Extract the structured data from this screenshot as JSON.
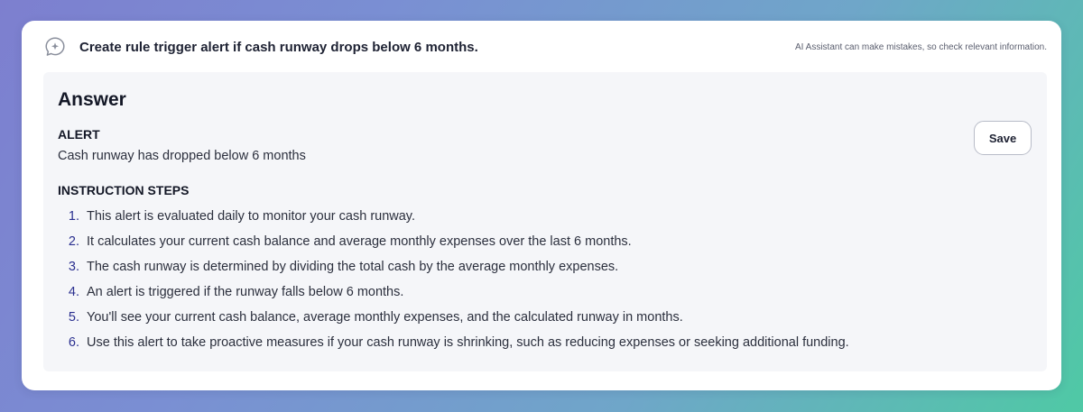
{
  "prompt": {
    "icon": "chat-sparkle-icon",
    "text": "Create rule trigger alert if cash runway drops below 6 months."
  },
  "disclaimer": "AI Assistant can make mistakes, so check relevant information.",
  "answer": {
    "title": "Answer",
    "save_label": "Save",
    "alert_label": "ALERT",
    "alert_text": "Cash runway has dropped below 6 months",
    "steps_heading": "INSTRUCTION STEPS",
    "steps": [
      {
        "num": "1.",
        "text": "This alert is evaluated daily to monitor your cash runway."
      },
      {
        "num": "2.",
        "text": "It calculates your current cash balance and average monthly expenses over the last 6 months."
      },
      {
        "num": "3.",
        "text": "The cash runway is determined by dividing the total cash by the average monthly expenses."
      },
      {
        "num": "4.",
        "text": "An alert is triggered if the runway falls below 6 months."
      },
      {
        "num": "5.",
        "text": "You'll see your current cash balance, average monthly expenses, and the calculated runway in months."
      },
      {
        "num": "6.",
        "text": "Use this alert to take proactive measures if your cash runway is shrinking, such as reducing expenses or seeking additional funding."
      }
    ]
  },
  "colors": {
    "accent_number": "#2a2f8f",
    "text": "#2b2f3d",
    "panel_bg": "#f5f6f9"
  }
}
